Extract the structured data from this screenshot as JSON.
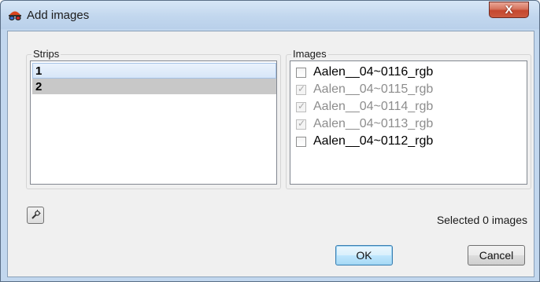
{
  "window": {
    "title": "Add images",
    "close_label": "X"
  },
  "strips": {
    "label": "Strips",
    "items": [
      "1",
      "2"
    ],
    "selected_index": 0
  },
  "images": {
    "label": "Images",
    "items": [
      {
        "name": "Aalen__04~0116_rgb",
        "checked": false,
        "enabled": true
      },
      {
        "name": "Aalen__04~0115_rgb",
        "checked": true,
        "enabled": false
      },
      {
        "name": "Aalen__04~0114_rgb",
        "checked": true,
        "enabled": false
      },
      {
        "name": "Aalen__04~0113_rgb",
        "checked": true,
        "enabled": false
      },
      {
        "name": "Aalen__04~0112_rgb",
        "checked": false,
        "enabled": true
      }
    ]
  },
  "status": {
    "selected_text": "Selected 0 images"
  },
  "buttons": {
    "ok": "OK",
    "cancel": "Cancel"
  },
  "icons": {
    "app": "stereo-glasses-icon",
    "tool": "magic-wand-icon",
    "check": "checkmark-icon"
  },
  "colors": {
    "title_bar": "#c2d7ee",
    "close_button": "#c5472e",
    "selected_row": "#d7e6f8",
    "highlight_row": "#c8c8c8",
    "disabled_text": "#8d8d8d"
  }
}
